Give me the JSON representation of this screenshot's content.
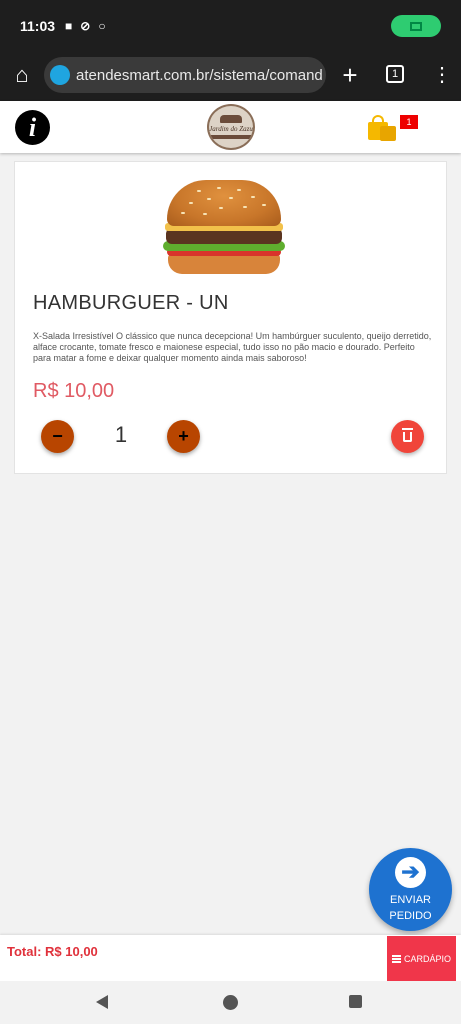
{
  "status_bar": {
    "time": "11:03",
    "icons": [
      "video-icon",
      "do-not-disturb-icon",
      "circle-icon"
    ],
    "camera_indicator_color": "#2ecc71"
  },
  "browser": {
    "url": "atendesmart.com.br/sistema/comand",
    "tab_count": "1",
    "icons": [
      "home-icon",
      "new-tab-icon",
      "tabs-icon",
      "more-icon"
    ]
  },
  "app_header": {
    "info_glyph": "i",
    "logo_text": "Jardim do Zazu",
    "cart_count": "1"
  },
  "product": {
    "title": "HAMBURGUER - UN",
    "description": "X-Salada Irresistível O clássico que nunca decepciona! Um hambúrguer suculento, queijo derretido, alface crocante, tomate fresco e maionese especial, tudo isso no pão macio e dourado. Perfeito para matar a fome e deixar qualquer momento ainda mais saboroso!",
    "price": "R$ 10,00",
    "quantity": "1",
    "minus_glyph": "−",
    "plus_glyph": "+"
  },
  "send_button": {
    "line1": "ENVIAR",
    "line2": "PEDIDO",
    "arrow_glyph": "➔"
  },
  "footer": {
    "total": "Total: R$ 10,00",
    "menu_button": "CARDÁPIO"
  },
  "colors": {
    "price": "#e05a63",
    "quantity_buttons": "#b84500",
    "delete_button": "#f0453a",
    "send_button": "#1e72d0",
    "total_text": "#e0313b",
    "menu_button": "#f0364a",
    "cart_badge": "#ee0000"
  }
}
